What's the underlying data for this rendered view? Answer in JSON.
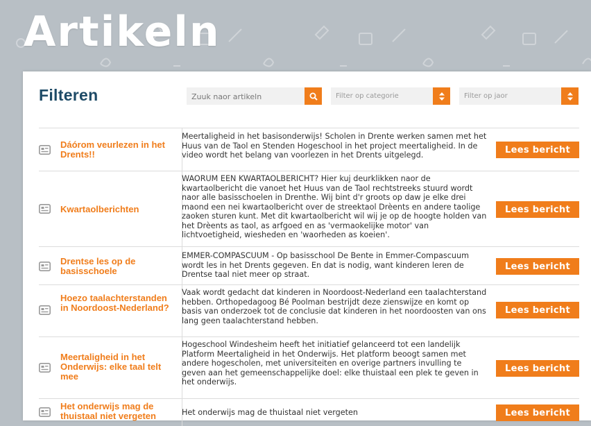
{
  "page": {
    "title": "Artikeln"
  },
  "filters": {
    "title": "Filteren",
    "search_placeholder": "Zuuk naor artikeln",
    "category_placeholder": "Filter op categorie",
    "year_placeholder": "Filter op jaor",
    "accent_color": "#f07d1b"
  },
  "articles": [
    {
      "title": "Dáórom veurlezen in het Drents!!",
      "description": "Meertaligheid in het basisonderwijs! Scholen in Drente werken samen met het Huus van de Taol en Stenden Hogeschool in het project meertaligheid. In de video wordt het belang van voorlezen in het Drents uitgelegd.",
      "button": "Lees bericht"
    },
    {
      "title": "Kwartaolberichten",
      "description": "WAORUM EEN KWARTAOLBERICHT? Hier kuj deurklikken naor de kwartaolbericht die vanoet het Huus van de Taol rechtstreeks stuurd wordt naor alle basisschoelen in Drenthe. Wij bint d'r groots op daw je elke drei maond een nei kwartaolbericht over de streektaol Drèents en andere taolige zaoken sturen kunt. Met dit kwartaolbericht wil wij je op de hoogte holden van het Drèents as taol, as arfgoed en as 'vermaokelijke motor' van lichtvoetigheid, wiesheden en 'waorheden as koeien'.",
      "button": "Lees bericht"
    },
    {
      "title": "Drentse les op de basisschoele",
      "description": "EMMER-COMPASCUUM - Op basisschool De Bente in Emmer-Compascuum wordt les in het Drents gegeven. En dat is nodig, want kinderen leren de Drentse taal niet meer op straat.",
      "button": "Lees bericht"
    },
    {
      "title": "Hoezo taalachterstanden in Noordoost-Nederland?",
      "description": "Vaak wordt gedacht dat kinderen in Noordoost-Nederland een taalachterstand hebben. Orthopedagoog Bé Poolman bestrijdt deze zienswijze en komt op basis van onderzoek tot de conclusie dat kinderen in het noordoosten van ons lang geen taalachterstand hebben.",
      "button": "Lees bericht"
    },
    {
      "title": "Meertaligheid in het Onderwijs: elke taal telt mee",
      "description": "Hogeschool Windesheim heeft het initiatief gelanceerd tot een landelijk Platform Meertaligheid in het Onderwijs. Het platform beoogt samen met andere hogescholen, met universiteiten en overige partners invulling te geven aan het gemeenschappelijke doel: elke thuistaal een plek te geven in het onderwijs.",
      "button": "Lees bericht"
    },
    {
      "title": "Het onderwijs mag de thuistaal niet vergeten",
      "description": "Het onderwijs mag de thuistaal niet vergeten",
      "button": "Lees bericht"
    }
  ]
}
